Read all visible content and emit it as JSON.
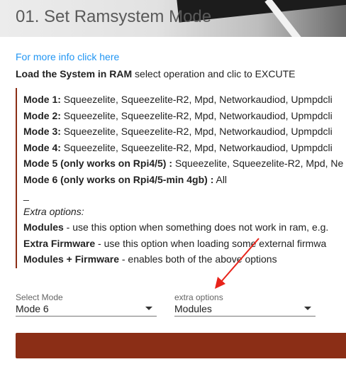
{
  "header": {
    "title": "01. Set Ramsystem Mode"
  },
  "info_link": "For more info click here",
  "instruction": {
    "bold": "Load the System in RAM",
    "rest": " select operation and clic to EXCUTE"
  },
  "modes": [
    {
      "label": "Mode 1:",
      "text": " Squeezelite, Squeezelite-R2, Mpd, Networkaudiod, Upmpdcli"
    },
    {
      "label": "Mode 2:",
      "text": " Squeezelite, Squeezelite-R2, Mpd, Networkaudiod, Upmpdcli"
    },
    {
      "label": "Mode 3:",
      "text": " Squeezelite, Squeezelite-R2, Mpd, Networkaudiod, Upmpdcli"
    },
    {
      "label": "Mode 4:",
      "text": " Squeezelite, Squeezelite-R2, Mpd, Networkaudiod, Upmpdcli"
    },
    {
      "label": "Mode 5 (only works on Rpi4/5) :",
      "text": " Squeezelite, Squeezelite-R2, Mpd, Ne"
    },
    {
      "label": "Mode 6 (only works on Rpi4/5-min 4gb) :",
      "text": " All"
    }
  ],
  "separator": "_",
  "extra_heading": "Extra options:",
  "extra_options": [
    {
      "label": "Modules",
      "text": " - use this option when something does not work in ram, e.g."
    },
    {
      "label": "Extra Firmware",
      "text": " - use this option when loading some external firmwa"
    },
    {
      "label": "Modules + Firmware",
      "text": " - enables both of the above options"
    }
  ],
  "select_mode": {
    "label": "Select Mode",
    "value": "Mode 6"
  },
  "extra_select": {
    "label": "extra options",
    "value": "Modules"
  },
  "colors": {
    "accent": "#8b2e16",
    "link": "#2196f3",
    "annotation_arrow": "#e8231a"
  }
}
